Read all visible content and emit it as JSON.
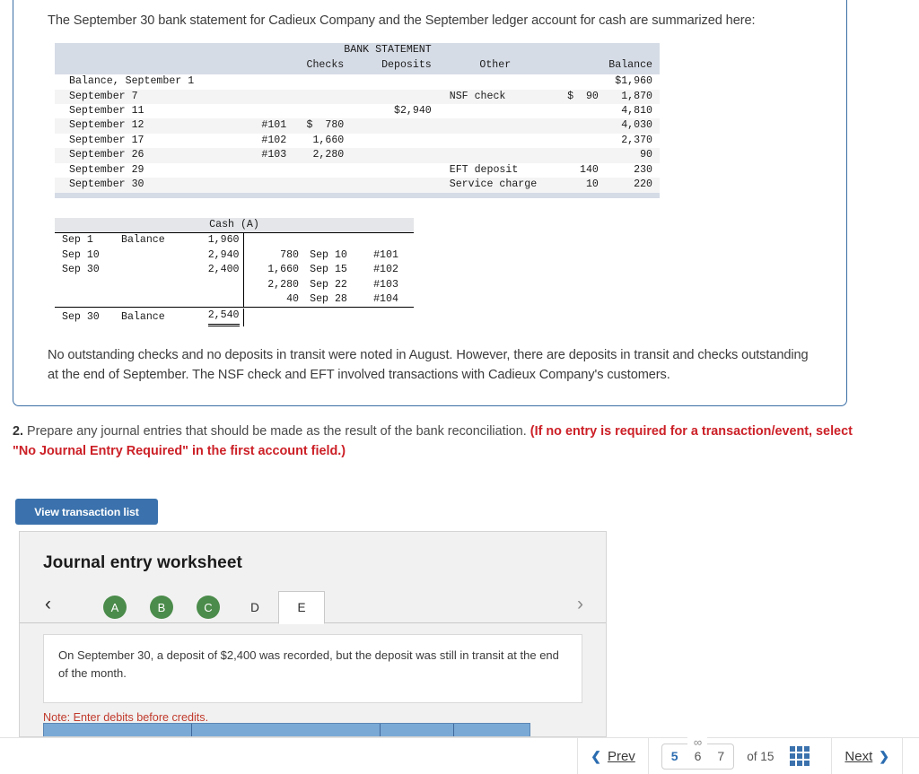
{
  "problem": {
    "intro": "The September 30 bank statement for Cadieux Company and the September ledger account for cash are summarized here:",
    "closing": "No outstanding checks and no deposits in transit were noted in August. However, there are deposits in transit and checks outstanding at the end of September. The NSF check and EFT involved transactions with Cadieux Company's customers."
  },
  "bank_statement": {
    "title": "BANK STATEMENT",
    "columns": [
      "Checks",
      "Deposits",
      "Other",
      "Balance"
    ],
    "rows": [
      {
        "date": "Balance, September 1",
        "check_no": "",
        "check_amt": "",
        "deposit": "",
        "other_label": "",
        "other_amt": "",
        "balance": "$1,960"
      },
      {
        "date": "September 7",
        "check_no": "",
        "check_amt": "",
        "deposit": "",
        "other_label": "NSF check",
        "other_amt": "$  90",
        "balance": "1,870"
      },
      {
        "date": "September 11",
        "check_no": "",
        "check_amt": "",
        "deposit": "$2,940",
        "other_label": "",
        "other_amt": "",
        "balance": "4,810"
      },
      {
        "date": "September 12",
        "check_no": "#101",
        "check_amt": "$  780",
        "deposit": "",
        "other_label": "",
        "other_amt": "",
        "balance": "4,030"
      },
      {
        "date": "September 17",
        "check_no": "#102",
        "check_amt": "1,660",
        "deposit": "",
        "other_label": "",
        "other_amt": "",
        "balance": "2,370"
      },
      {
        "date": "September 26",
        "check_no": "#103",
        "check_amt": "2,280",
        "deposit": "",
        "other_label": "",
        "other_amt": "",
        "balance": "90"
      },
      {
        "date": "September 29",
        "check_no": "",
        "check_amt": "",
        "deposit": "",
        "other_label": "EFT deposit",
        "other_amt": "140",
        "balance": "230"
      },
      {
        "date": "September 30",
        "check_no": "",
        "check_amt": "",
        "deposit": "",
        "other_label": "Service charge",
        "other_amt": "10",
        "balance": "220"
      }
    ]
  },
  "cash_account": {
    "title": "Cash (A)",
    "debit_rows": [
      {
        "date": "Sep 1",
        "label": "Balance",
        "amount": "1,960"
      },
      {
        "date": "Sep 10",
        "label": "",
        "amount": "2,940"
      },
      {
        "date": "Sep 30",
        "label": "",
        "amount": "2,400"
      },
      {
        "date": "",
        "label": "",
        "amount": ""
      }
    ],
    "credit_rows": [
      {
        "amount": "",
        "date": "",
        "ref": ""
      },
      {
        "amount": "780",
        "date": "Sep 10",
        "ref": "#101"
      },
      {
        "amount": "1,660",
        "date": "Sep 15",
        "ref": "#102"
      },
      {
        "amount": "2,280",
        "date": "Sep 22",
        "ref": "#103"
      },
      {
        "amount": "40",
        "date": "Sep 28",
        "ref": "#104"
      }
    ],
    "ending": {
      "date": "Sep 30",
      "label": "Balance",
      "amount": "2,540"
    }
  },
  "question2": {
    "number": "2.",
    "text": "Prepare any journal entries that should be made as the result of the bank reconciliation.",
    "red_note": "(If no entry is required for a transaction/event, select \"No Journal Entry Required\" in the first account field.)"
  },
  "view_transaction_button": "View transaction list",
  "worksheet": {
    "title": "Journal entry worksheet",
    "prev_arrow": "‹",
    "next_arrow": "›",
    "tabs": [
      {
        "label": "A",
        "state": "complete"
      },
      {
        "label": "B",
        "state": "complete"
      },
      {
        "label": "C",
        "state": "complete"
      },
      {
        "label": "D",
        "state": "pending"
      },
      {
        "label": "E",
        "state": "active"
      }
    ],
    "description": "On September 30, a deposit of $2,400 was recorded, but the deposit was still in transit at the end of the month.",
    "note": "Note: Enter debits before credits."
  },
  "bottom_nav": {
    "prev_label": "Prev",
    "next_label": "Next",
    "prev_chevron": "❮",
    "next_chevron": "❯",
    "pages": [
      "5",
      "6",
      "7"
    ],
    "current_page": "6",
    "selected_page": "5",
    "of_text": "of 15",
    "link_glyph": "∞",
    "grid_icon": "grid-icon"
  },
  "colors": {
    "accent_blue": "#3b72ad",
    "border_blue": "#3a6ea5",
    "red_note": "#cc2027",
    "tab_green": "#4b8b4b",
    "table_header": "#d6dce6"
  }
}
